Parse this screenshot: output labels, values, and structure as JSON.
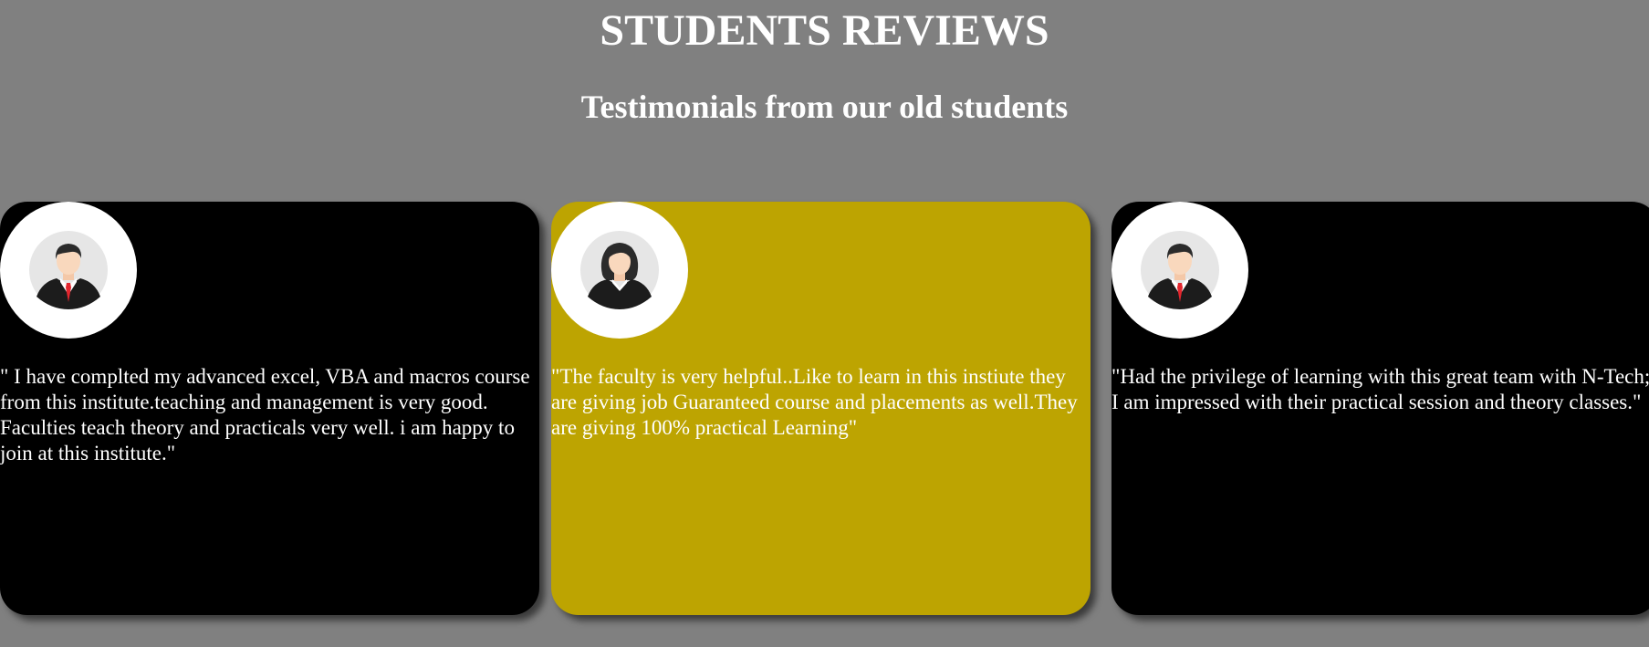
{
  "header": {
    "title": "STUDENTS REVIEWS",
    "subtitle": "Testimonials from our old students"
  },
  "reviews": [
    {
      "avatar_icon": "male-student-avatar-icon",
      "card_color": "#000000",
      "quote": "\" I have complted my advanced excel, VBA and macros course from this institute.teaching and management is very good. Faculties teach theory and practicals very well. i am happy to join at this institute.\""
    },
    {
      "avatar_icon": "female-student-avatar-icon",
      "card_color": "#bda401",
      "quote": "\"The faculty is very helpful..Like to learn in this instiute they are giving job Guaranteed course and placements as well.They are giving 100% practical Learning\""
    },
    {
      "avatar_icon": "male-student-avatar-icon",
      "card_color": "#000000",
      "quote": "\"Had the privilege of learning with this great team with N-Tech; I am impressed with their practical session and theory classes.\""
    }
  ],
  "colors": {
    "page_background": "#808080",
    "text": "#ffffff",
    "avatar_background": "#ffffff"
  }
}
